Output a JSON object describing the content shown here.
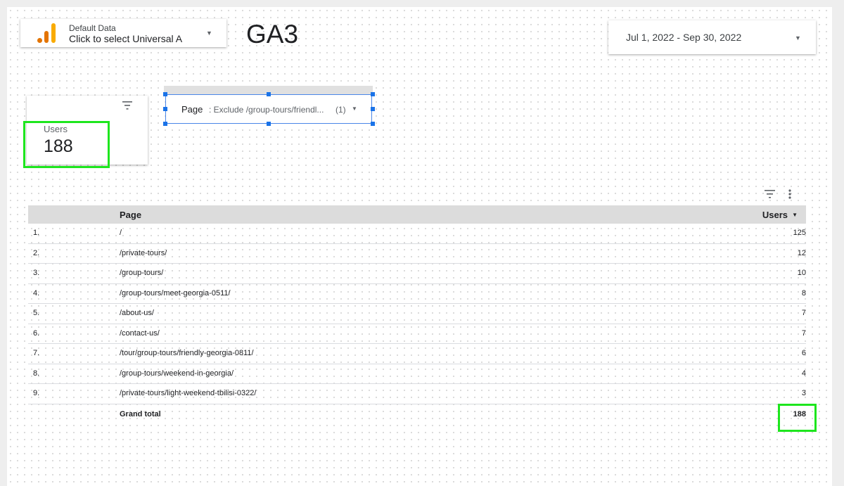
{
  "header": {
    "data_source": {
      "label": "Default Data",
      "value": "Click to select Universal A"
    },
    "title": "GA3",
    "date_range": "Jul 1, 2022 - Sep 30, 2022"
  },
  "scorecard": {
    "label": "Users",
    "value": "188"
  },
  "filter_control": {
    "dimension": "Page",
    "value": ": Exclude /group-tours/friendl...",
    "count": "(1)"
  },
  "table": {
    "columns": [
      "Page",
      "Users"
    ],
    "rows": [
      {
        "index": "1.",
        "page": "/",
        "users": "125"
      },
      {
        "index": "2.",
        "page": "/private-tours/",
        "users": "12"
      },
      {
        "index": "3.",
        "page": "/group-tours/",
        "users": "10"
      },
      {
        "index": "4.",
        "page": "/group-tours/meet-georgia-0511/",
        "users": "8"
      },
      {
        "index": "5.",
        "page": "/about-us/",
        "users": "7"
      },
      {
        "index": "6.",
        "page": "/contact-us/",
        "users": "7"
      },
      {
        "index": "7.",
        "page": "/tour/group-tours/friendly-georgia-0811/",
        "users": "6"
      },
      {
        "index": "8.",
        "page": "/group-tours/weekend-in-georgia/",
        "users": "4"
      },
      {
        "index": "9.",
        "page": "/private-tours/light-weekend-tbilisi-0322/",
        "users": "3"
      }
    ],
    "grand_total_label": "Grand total",
    "grand_total_value": "188"
  },
  "colors": {
    "highlight": "#1ee61e",
    "selection": "#1a73e8",
    "ga_orange": "#f9ab00",
    "ga_dark_orange": "#e37400"
  },
  "icons": [
    "analytics-logo-icon",
    "filter-icon",
    "more-vert-icon",
    "chevron-down-icon",
    "sort-desc-icon"
  ]
}
